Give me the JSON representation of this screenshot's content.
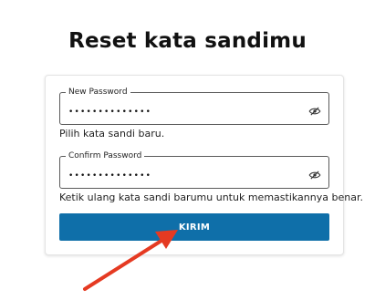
{
  "title": "Reset kata sandimu",
  "new_password": {
    "legend": "New Password",
    "value": "••••••••••••••",
    "helper": "Pilih kata sandi baru.",
    "toggle_icon": "eye-slash-icon"
  },
  "confirm_password": {
    "legend": "Confirm Password",
    "value": "••••••••••••••",
    "helper": "Ketik ulang kata sandi barumu untuk memastikannya benar.",
    "toggle_icon": "eye-slash-icon"
  },
  "submit_label": "KIRIM",
  "colors": {
    "button": "#0f6fa9",
    "arrow": "#e53a22"
  }
}
